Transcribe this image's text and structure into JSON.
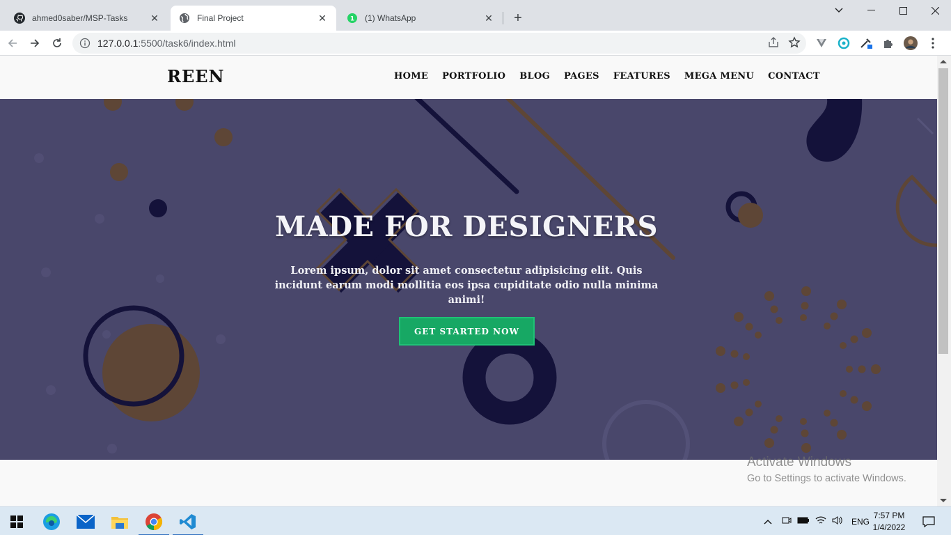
{
  "browser": {
    "tabs": [
      {
        "title": "ahmed0saber/MSP-Tasks",
        "icon": "github-icon"
      },
      {
        "title": "Final Project",
        "icon": "globe-icon",
        "active": true
      },
      {
        "title": "(1) WhatsApp",
        "icon": "whatsapp-icon",
        "badge": "1"
      }
    ],
    "url_host": "127.0.0.1",
    "url_path": ":5500/task6/index.html"
  },
  "site": {
    "logo": "REEN",
    "menu": [
      "HOME",
      "PORTFOLIO",
      "BLOG",
      "PAGES",
      "FEATURES",
      "MEGA MENU",
      "CONTACT"
    ],
    "hero": {
      "title": "MADE FOR DESIGNERS",
      "text": "Lorem ipsum, dolor sit amet consectetur adipisicing elit. Quis incidunt earum modi mollitia eos ipsa cupiditate odio nulla minima animi!",
      "cta": "GET STARTED NOW"
    },
    "colors": {
      "hero_bg": "#49476b",
      "accent_brown": "#5e4636",
      "navy": "#14123a",
      "cta": "#17a864"
    }
  },
  "watermark": {
    "line1": "Activate Windows",
    "line2": "Go to Settings to activate Windows."
  },
  "taskbar": {
    "apps": [
      "windows-start-icon",
      "edge-icon",
      "mail-icon",
      "file-explorer-icon",
      "chrome-icon",
      "vscode-icon"
    ],
    "language": "ENG",
    "time": "7:57 PM",
    "date": "1/4/2022"
  }
}
